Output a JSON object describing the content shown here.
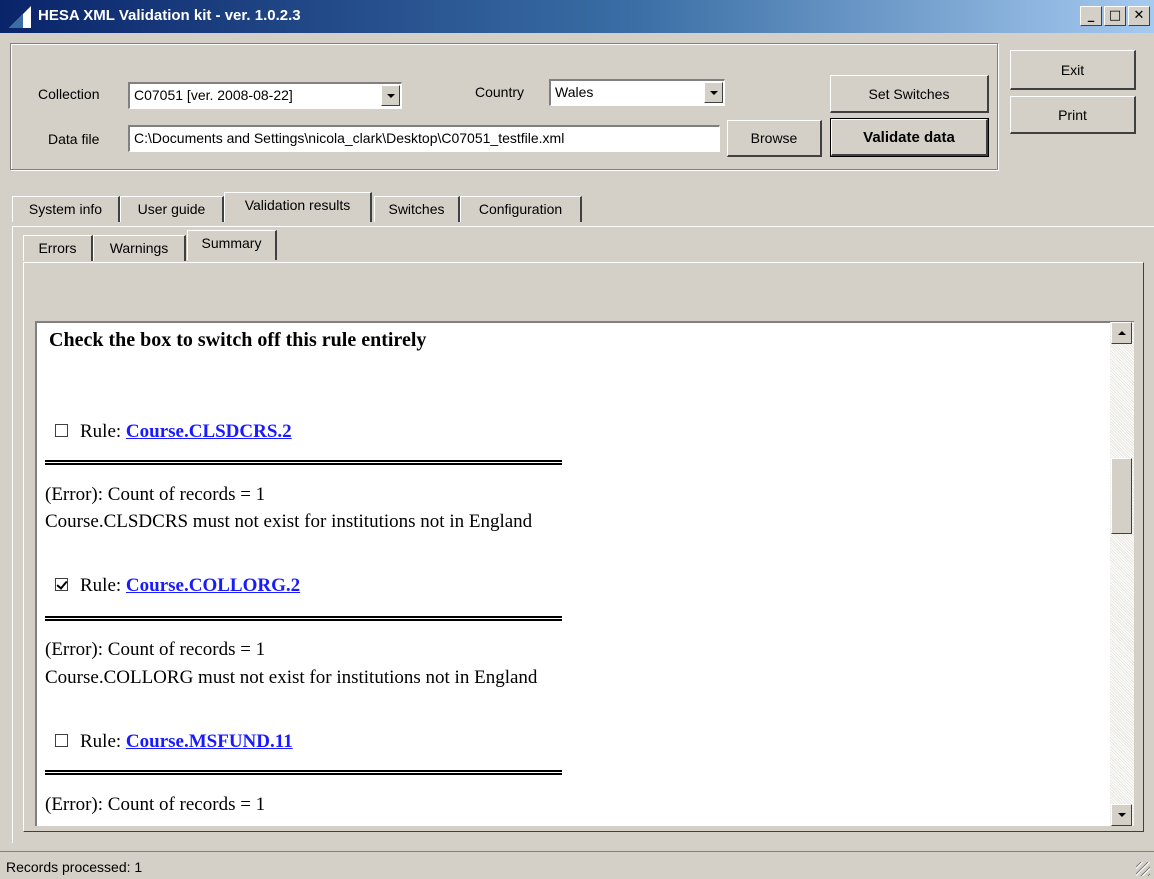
{
  "window": {
    "title": "HESA XML Validation kit - ver. 1.0.2.3",
    "caption_buttons": {
      "minimize": "_",
      "maximize": "□",
      "close": "✕"
    }
  },
  "form": {
    "collection_label": "Collection",
    "collection_value": "C07051 [ver. 2008-08-22]",
    "country_label": "Country",
    "country_value": "Wales",
    "datafile_label": "Data file",
    "datafile_value": "C:\\Documents and Settings\\nicola_clark\\Desktop\\C07051_testfile.xml",
    "browse_label": "Browse",
    "set_switches_label": "Set Switches",
    "validate_label": "Validate data",
    "exit_label": "Exit",
    "print_label": "Print"
  },
  "tabs": [
    {
      "label": "System info"
    },
    {
      "label": "User guide"
    },
    {
      "label": "Validation results",
      "active": true
    },
    {
      "label": "Switches"
    },
    {
      "label": "Configuration"
    }
  ],
  "subtabs": [
    {
      "label": "Errors"
    },
    {
      "label": "Warnings"
    },
    {
      "label": "Summary",
      "active": true
    }
  ],
  "results": {
    "heading": "Check the box to switch off this rule entirely",
    "rule_prefix": "Rule:",
    "rules": [
      {
        "name": "Course.CLSDCRS.2",
        "checked": false,
        "count_line": "(Error): Count of records = 1",
        "description": "Course.CLSDCRS must not exist for institutions not in England"
      },
      {
        "name": "Course.COLLORG.2",
        "checked": true,
        "count_line": "(Error): Count of records = 1",
        "description": "Course.COLLORG must not exist for institutions not in England"
      },
      {
        "name": "Course.MSFUND.11",
        "checked": false,
        "count_line": "(Error): Count of records = 1",
        "description": ""
      }
    ]
  },
  "status": {
    "text": "Records processed: 1"
  },
  "colors": {
    "title_start": "#0a246a",
    "title_end": "#a6caf0",
    "link": "#1a1aff",
    "face": "#d4d0c8"
  }
}
